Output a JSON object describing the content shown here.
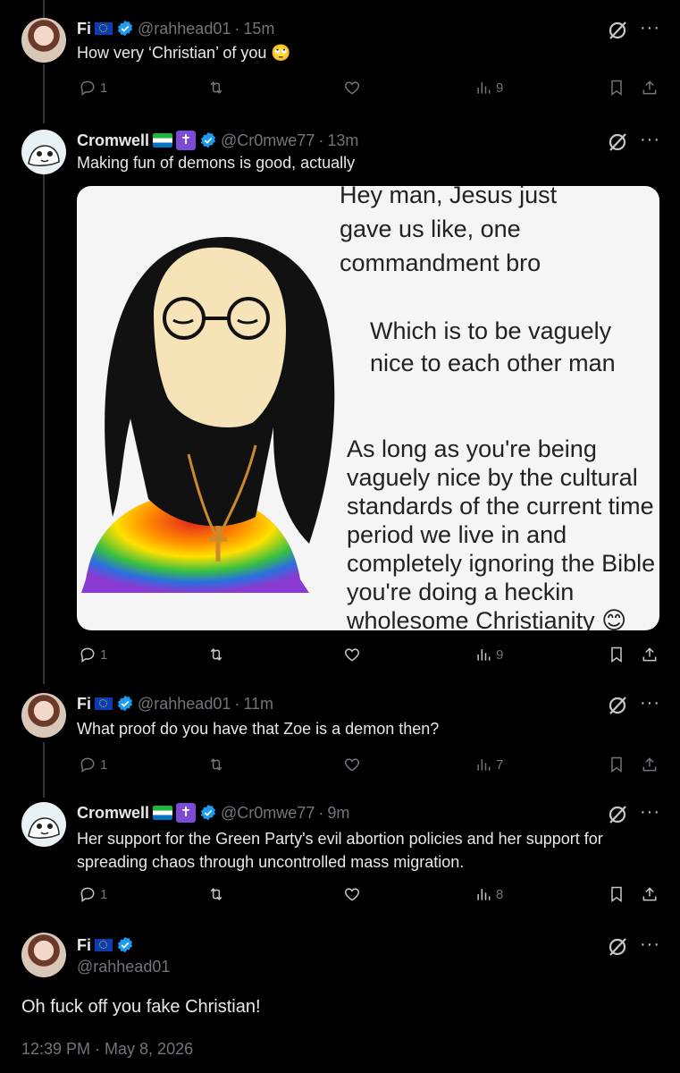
{
  "tweets": [
    {
      "name": "Fi",
      "handle": "@rahhead01",
      "time": "15m",
      "text": "How very ‘Christian’ of you 🙄",
      "replies": "1",
      "views": "9"
    },
    {
      "name": "Cromwell",
      "handle": "@Cr0mwe77",
      "time": "13m",
      "text": "Making fun of demons is good, actually",
      "replies": "1",
      "views": "9",
      "meme": {
        "line1": "Hey man, Jesus just",
        "line2": "gave us like, one",
        "line3": "commandment bro",
        "line4": "Which is to be vaguely",
        "line5": "nice to each other man",
        "line6": "As long as you're being",
        "line7": "vaguely nice by the cultural",
        "line8": "standards of the current time",
        "line9": "period we live in and",
        "line10": "completely ignoring the Bible",
        "line11": "you're doing a heckin",
        "line12": "wholesome Christianity 😊"
      }
    },
    {
      "name": "Fi",
      "handle": "@rahhead01",
      "time": "11m",
      "text": "What proof do you have that Zoe is a demon then?",
      "replies": "1",
      "views": "7"
    },
    {
      "name": "Cromwell",
      "handle": "@Cr0mwe77",
      "time": "9m",
      "text1": "Her support for the Green Party's evil abortion policies and her support for",
      "text2": "spreading chaos through uncontrolled mass migration.",
      "replies": "1",
      "views": "8"
    }
  ],
  "main": {
    "name": "Fi",
    "handle": "@rahhead01",
    "text": "Oh fuck off you fake Christian!",
    "timestamp": "12:39 PM · May 8, 2026"
  },
  "sep": "·",
  "more_glyph": "···",
  "icons": [
    "reply-icon",
    "retweet-icon",
    "like-icon",
    "views-icon",
    "bookmark-icon",
    "share-icon",
    "grok-icon",
    "verified-icon",
    "eu-flag-icon",
    "sierra-leone-flag-icon",
    "cross-emoji-icon"
  ],
  "colors": {
    "background": "#000000",
    "text": "#e7e9ea",
    "secondary": "#71767b",
    "verified": "#1d9bf0",
    "line": "#333639"
  }
}
